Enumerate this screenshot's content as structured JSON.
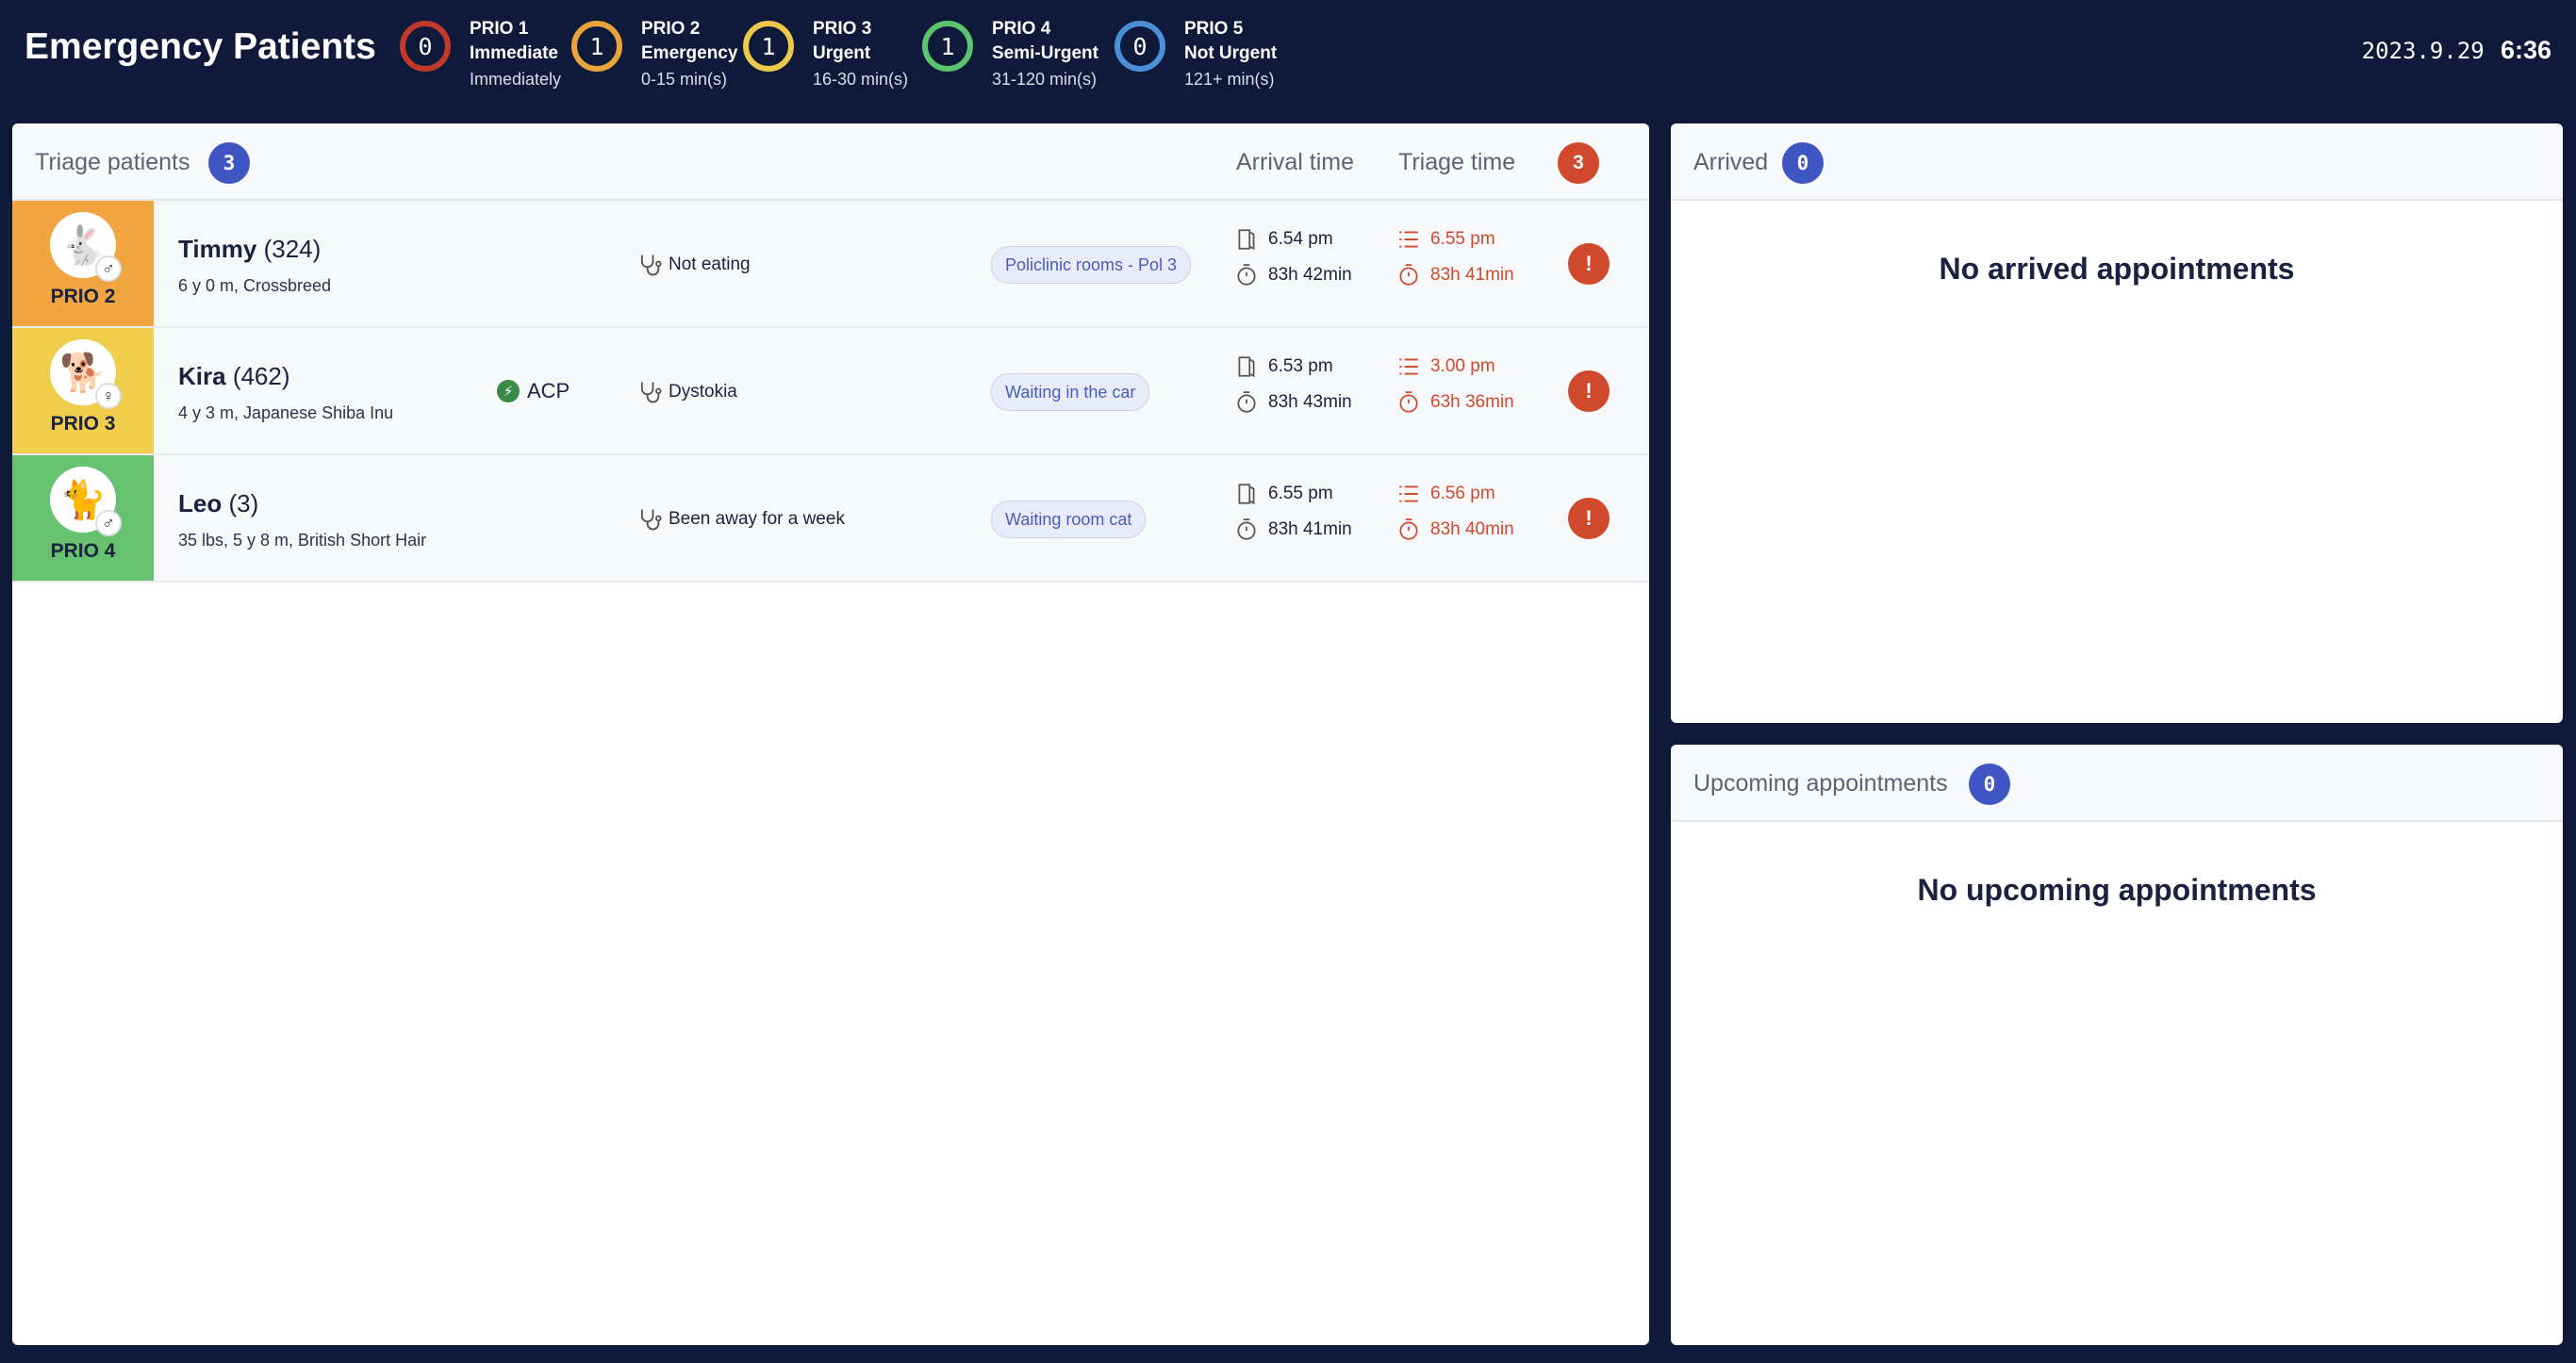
{
  "header": {
    "title": "Emergency Patients",
    "priorities": [
      {
        "count": "0",
        "label": "PRIO 1",
        "name": "Immediate",
        "range": "Immediately",
        "color": "#c0392b"
      },
      {
        "count": "1",
        "label": "PRIO 2",
        "name": "Emergency",
        "range": "0-15 min(s)",
        "color": "#e8a33a"
      },
      {
        "count": "1",
        "label": "PRIO 3",
        "name": "Urgent",
        "range": "16-30 min(s)",
        "color": "#ecc94b"
      },
      {
        "count": "1",
        "label": "PRIO 4",
        "name": "Semi-Urgent",
        "range": "31-120 min(s)",
        "color": "#5cc36e"
      },
      {
        "count": "0",
        "label": "PRIO 5",
        "name": "Not Urgent",
        "range": "121+ min(s)",
        "color": "#4a90d9"
      }
    ],
    "date": "2023.9.29",
    "time": "6:36"
  },
  "triage": {
    "title": "Triage patients",
    "count": "3",
    "arrival_header": "Arrival time",
    "triage_header": "Triage time",
    "alert_count": "3",
    "patients": [
      {
        "name": "Timmy",
        "id": "(324)",
        "details": "6 y 0 m, Crossbreed",
        "prio": "PRIO 2",
        "prio_color": "#f0a540",
        "avatar_icon": "rabbit-icon",
        "sex": "♂",
        "acp": "",
        "complaint": "Not eating",
        "location": "Policlinic rooms - Pol 3",
        "arrival_time": "6.54 pm",
        "arrival_elapsed": "83h 42min",
        "triage_time": "6.55 pm",
        "triage_elapsed": "83h 41min",
        "alert": "!"
      },
      {
        "name": "Kira",
        "id": "(462)",
        "details": "4 y 3 m, Japanese Shiba Inu",
        "prio": "PRIO 3",
        "prio_color": "#f1cd4b",
        "avatar_icon": "dog-icon",
        "sex": "♀",
        "acp": "ACP",
        "complaint": "Dystokia",
        "location": "Waiting in the car",
        "arrival_time": "6.53 pm",
        "arrival_elapsed": "83h 43min",
        "triage_time": "3.00 pm",
        "triage_elapsed": "63h 36min",
        "alert": "!"
      },
      {
        "name": "Leo",
        "id": "(3)",
        "details": "35 lbs, 5 y 8 m, British Short Hair",
        "prio": "PRIO 4",
        "prio_color": "#66c26f",
        "avatar_icon": "cat-icon",
        "sex": "♂",
        "acp": "",
        "complaint": "Been away for a week",
        "location": "Waiting room cat",
        "arrival_time": "6.55 pm",
        "arrival_elapsed": "83h 41min",
        "triage_time": "6.56 pm",
        "triage_elapsed": "83h 40min",
        "alert": "!"
      }
    ]
  },
  "arrived": {
    "title": "Arrived",
    "count": "0",
    "empty": "No arrived appointments"
  },
  "upcoming": {
    "title": "Upcoming appointments",
    "count": "0",
    "empty": "No upcoming appointments"
  }
}
